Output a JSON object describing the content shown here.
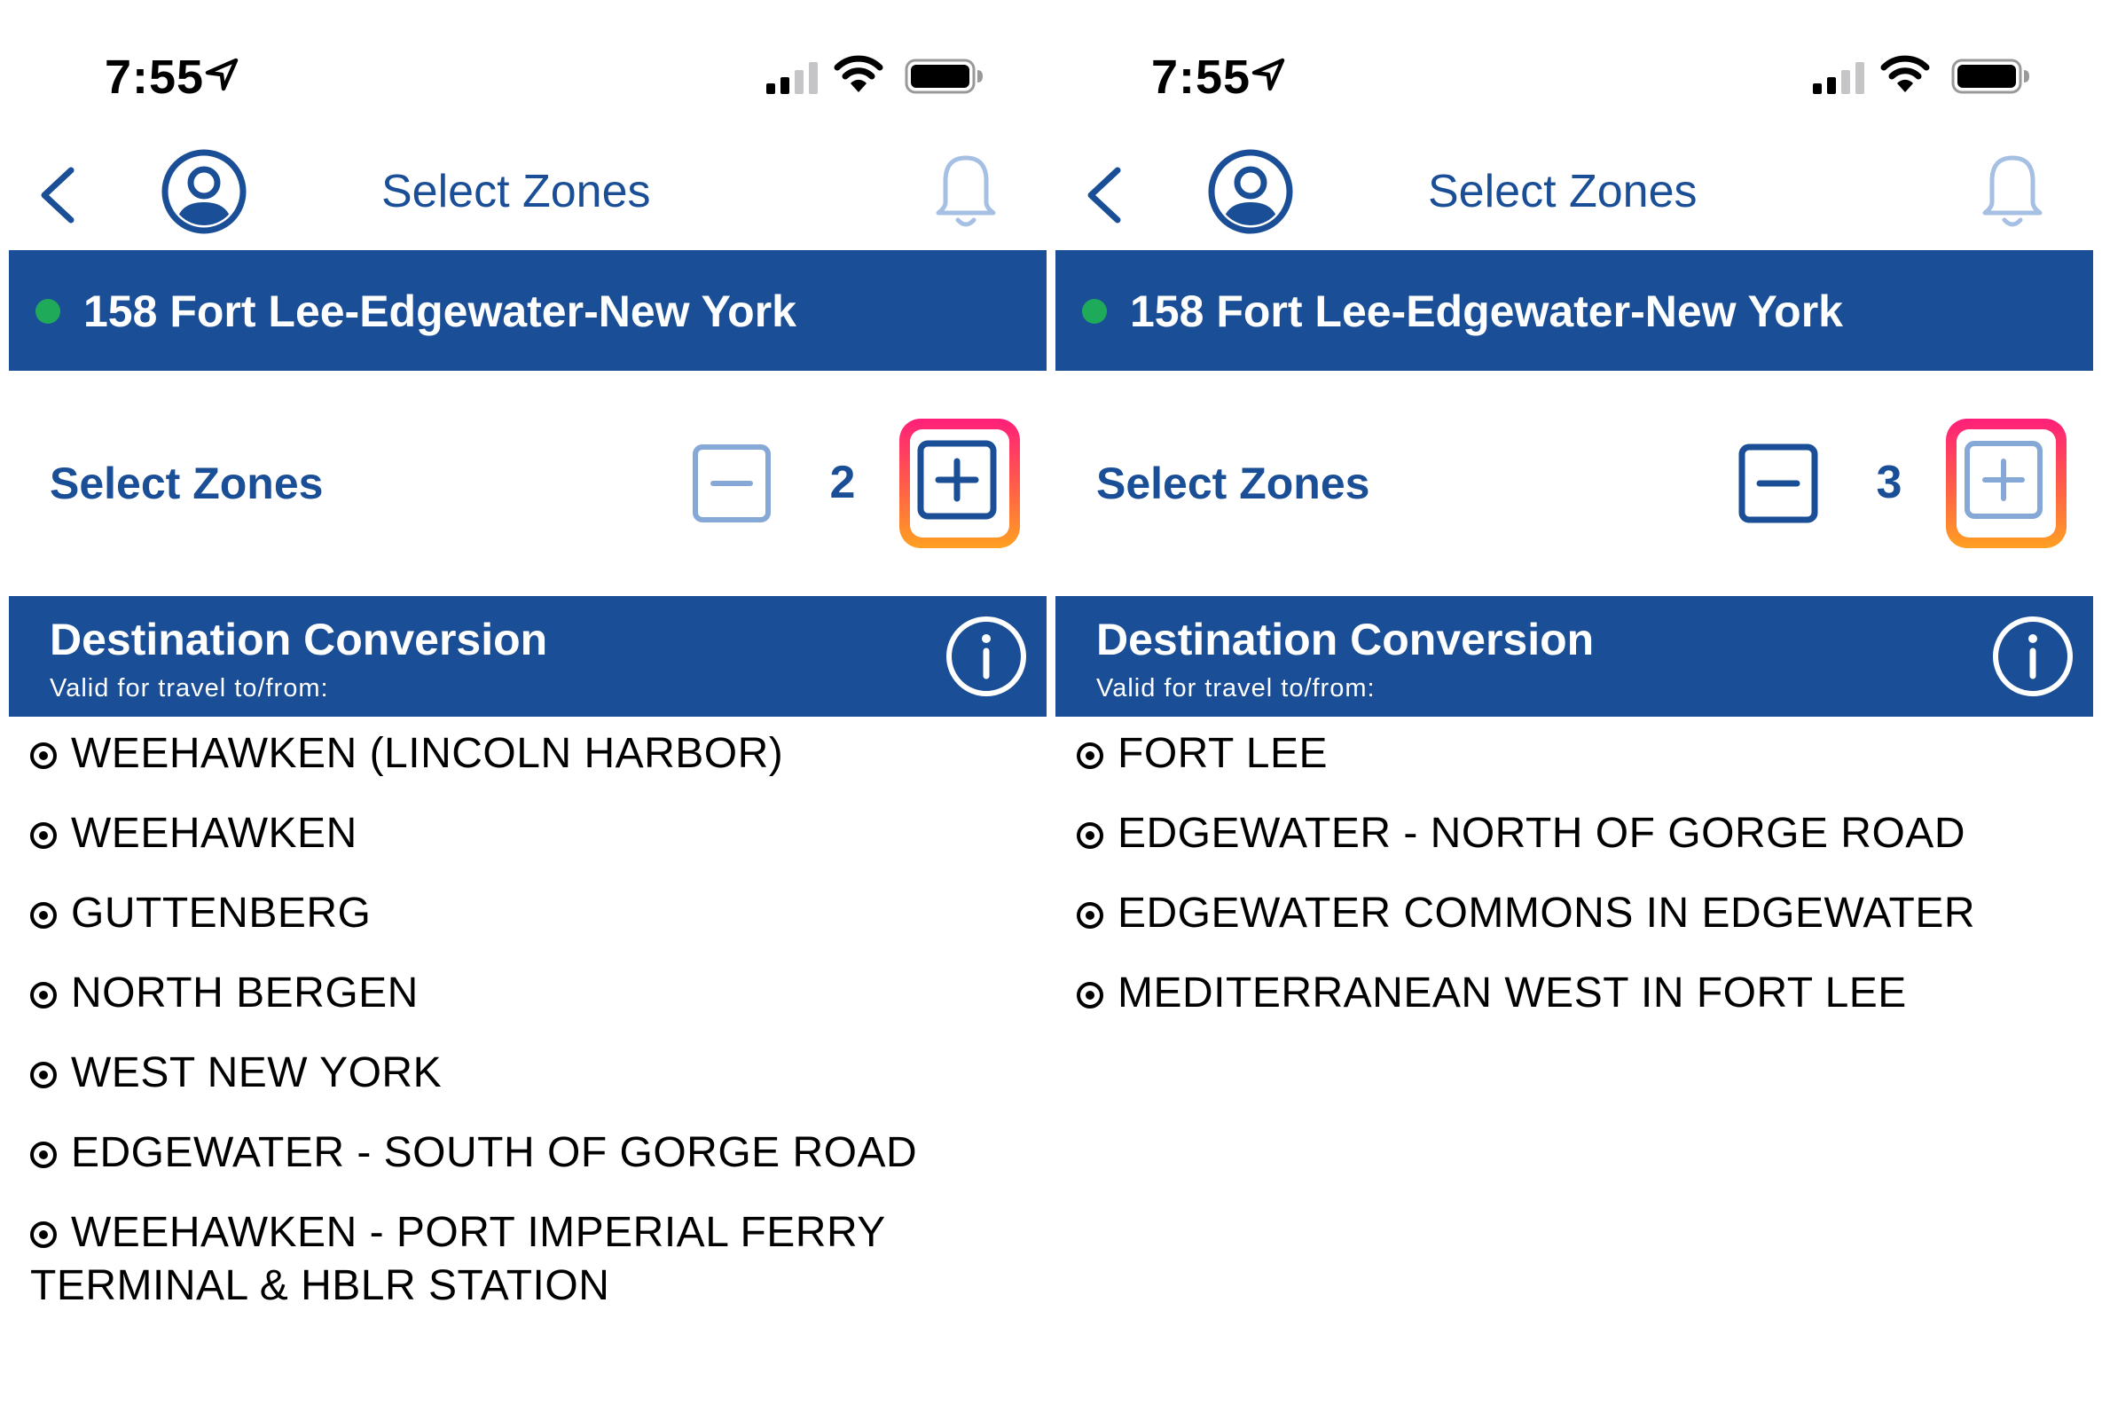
{
  "colors": {
    "brand_blue": "#1a4e96",
    "route_status_green": "#1faa5a",
    "highlight_gradient": [
      "#ff1f7a",
      "#ffa022"
    ]
  },
  "screens": [
    {
      "status_bar": {
        "time": "7:55",
        "icons": [
          "location-arrow-icon",
          "cellular-signal-icon",
          "wifi-icon",
          "battery-icon"
        ]
      },
      "nav": {
        "title": "Select Zones",
        "icons": [
          "back-chevron-icon",
          "profile-avatar-icon",
          "notification-bell-icon"
        ]
      },
      "route": {
        "name": "158 Fort Lee-Edgewater-New York"
      },
      "zones": {
        "label": "Select Zones",
        "count": "2",
        "minus_state": "disabled",
        "plus_state": "enabled",
        "plus_highlighted": true
      },
      "destination": {
        "title": "Destination Conversion",
        "subtitle": "Valid for travel to/from:",
        "items": [
          "WEEHAWKEN (LINCOLN HARBOR)",
          "WEEHAWKEN",
          "GUTTENBERG",
          "NORTH BERGEN",
          "WEST NEW YORK",
          "EDGEWATER - SOUTH OF GORGE ROAD",
          "WEEHAWKEN - PORT IMPERIAL FERRY TERMINAL & HBLR STATION"
        ]
      }
    },
    {
      "status_bar": {
        "time": "7:55",
        "icons": [
          "location-arrow-icon",
          "cellular-signal-icon",
          "wifi-icon",
          "battery-icon"
        ]
      },
      "nav": {
        "title": "Select Zones",
        "icons": [
          "back-chevron-icon",
          "profile-avatar-icon",
          "notification-bell-icon"
        ]
      },
      "route": {
        "name": "158 Fort Lee-Edgewater-New York"
      },
      "zones": {
        "label": "Select Zones",
        "count": "3",
        "minus_state": "enabled",
        "plus_state": "disabled",
        "plus_highlighted": true
      },
      "destination": {
        "title": "Destination Conversion",
        "subtitle": "Valid for travel to/from:",
        "items": [
          "FORT LEE",
          "EDGEWATER - NORTH OF GORGE ROAD",
          "EDGEWATER COMMONS IN EDGEWATER",
          "MEDITERRANEAN WEST IN FORT LEE"
        ]
      }
    }
  ]
}
